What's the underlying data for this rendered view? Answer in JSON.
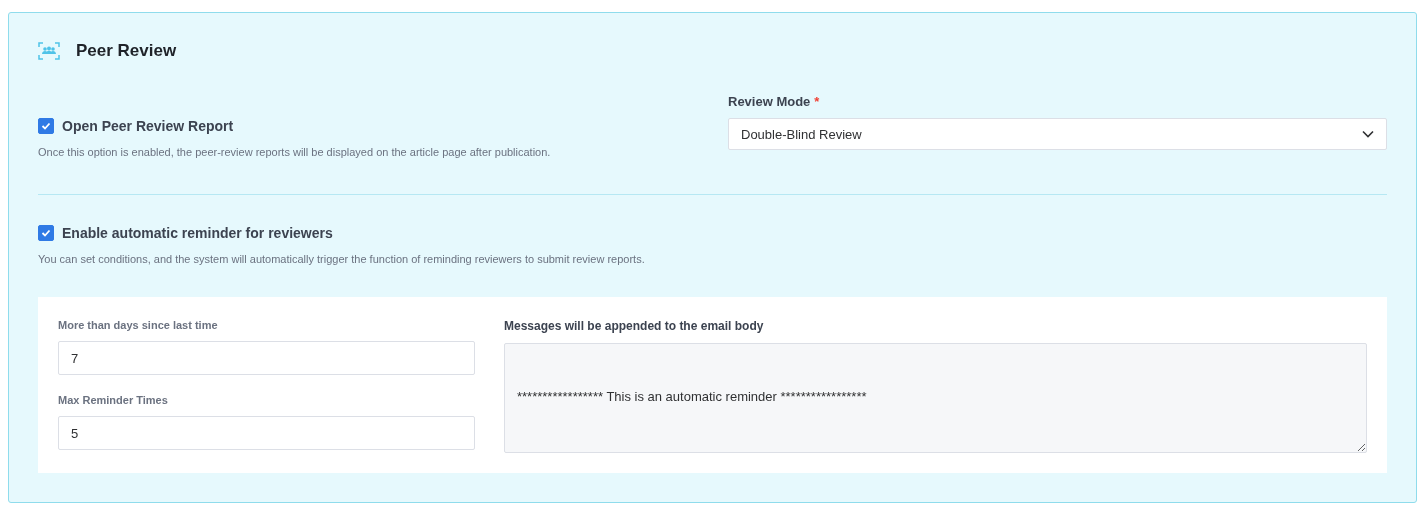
{
  "panel": {
    "title": "Peer Review"
  },
  "open_report": {
    "label": "Open Peer Review Report",
    "checked": true,
    "description": "Once this option is enabled, the peer-review reports will be displayed on the article page after publication."
  },
  "review_mode": {
    "label": "Review Mode",
    "required_mark": "*",
    "value": "Double-Blind Review"
  },
  "reminder": {
    "label": "Enable automatic reminder for reviewers",
    "checked": true,
    "description": "You can set conditions, and the system will automatically trigger the function of reminding reviewers to submit review reports."
  },
  "reminder_settings": {
    "days": {
      "label": "More than days since last time",
      "value": "7"
    },
    "max_times": {
      "label": "Max Reminder Times",
      "value": "5"
    },
    "message": {
      "label": "Messages will be appended to the email body",
      "value": "***************** This is an automatic reminder *****************"
    }
  }
}
